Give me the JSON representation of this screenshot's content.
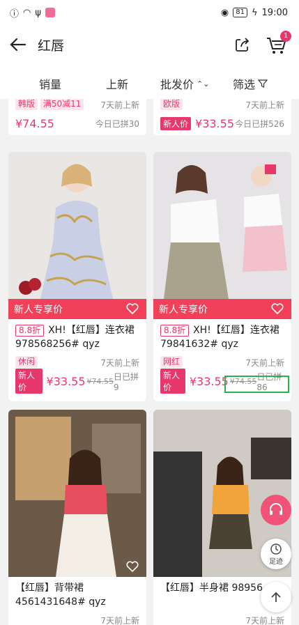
{
  "status": {
    "time": "19:00",
    "battery": "81"
  },
  "header": {
    "title": "红唇",
    "cart_count": "1"
  },
  "sort": {
    "sales": "销量",
    "new": "上新",
    "wholesale": "批发价",
    "filter": "筛选"
  },
  "top_row": {
    "left": {
      "tags": [
        "韩版",
        "满50减11"
      ],
      "days": "7天前上新",
      "price": "¥74.55",
      "sold": "今日已拼30"
    },
    "right": {
      "tags": [
        "欧版"
      ],
      "days": "7天前上新",
      "new_price_label": "新人价",
      "price": "¥33.55",
      "sold": "今日已拼526"
    }
  },
  "products": [
    {
      "promo": "新人专享价",
      "discount": "8.8折",
      "title": "XH!【红唇】连衣裙978568256# qyz",
      "tag": "休闲",
      "days": "7天前上新",
      "new_price_label": "新人价",
      "price": "¥33.55",
      "old_price": "¥74.55",
      "sold": "日已拼9"
    },
    {
      "promo": "新人专享价",
      "discount": "8.8折",
      "title": "XH!【红唇】连衣裙79841632# qyz",
      "tag": "网红",
      "days": "7天前上新",
      "new_price_label": "新人价",
      "price": "¥33.55",
      "old_price": "¥74.55",
      "sold": "日已拼86"
    },
    {
      "title": "【红唇】背带裙4561431648# qyz",
      "days": "7天前上新"
    },
    {
      "title": "【红唇】半身裙 98956",
      "days": "7天前上新"
    }
  ],
  "fab": {
    "trace_label": "足迹"
  },
  "colors": {
    "accent": "#e8386b",
    "promo_bar": "#f0405a",
    "highlight": "#2bb34b"
  }
}
